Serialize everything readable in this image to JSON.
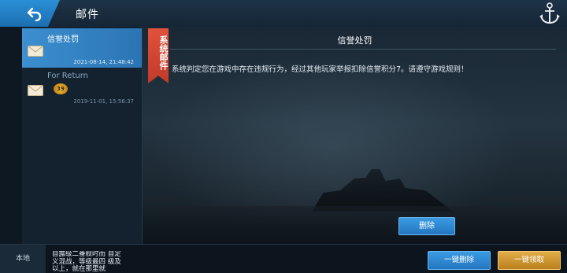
{
  "header": {
    "title": "邮件",
    "back_icon": "back-arrow-icon",
    "anchor_icon": "anchor-icon"
  },
  "mail_list": [
    {
      "subject": "信誉处罚",
      "time": "2021-08-14, 21:48:42",
      "icon": "envelope-icon",
      "selected": true
    },
    {
      "subject": "For Return",
      "time": "2019-11-01, 15:56:37",
      "icon": "envelope-icon",
      "reward": "39",
      "selected": false
    }
  ],
  "mail_view": {
    "ribbon_label": "系统邮件",
    "title": "信誉处罚",
    "body": "系统判定您在游戏中存在违规行为，经过其他玩家举报扣除信誉积分7。请遵守游戏规则！",
    "delete_label": "删除"
  },
  "bottom_bar": {
    "local_label": "本地",
    "ticker_text": "自露级二番舰时而 自定义混战，等级最四 级及以上，就在那里就",
    "onekey_delete_label": "一键删除",
    "onekey_claim_label": "一键领取"
  },
  "colors": {
    "accent_blue": "#2b84cf",
    "ribbon_red": "#d2432f",
    "claim_gold": "#d29a33"
  }
}
